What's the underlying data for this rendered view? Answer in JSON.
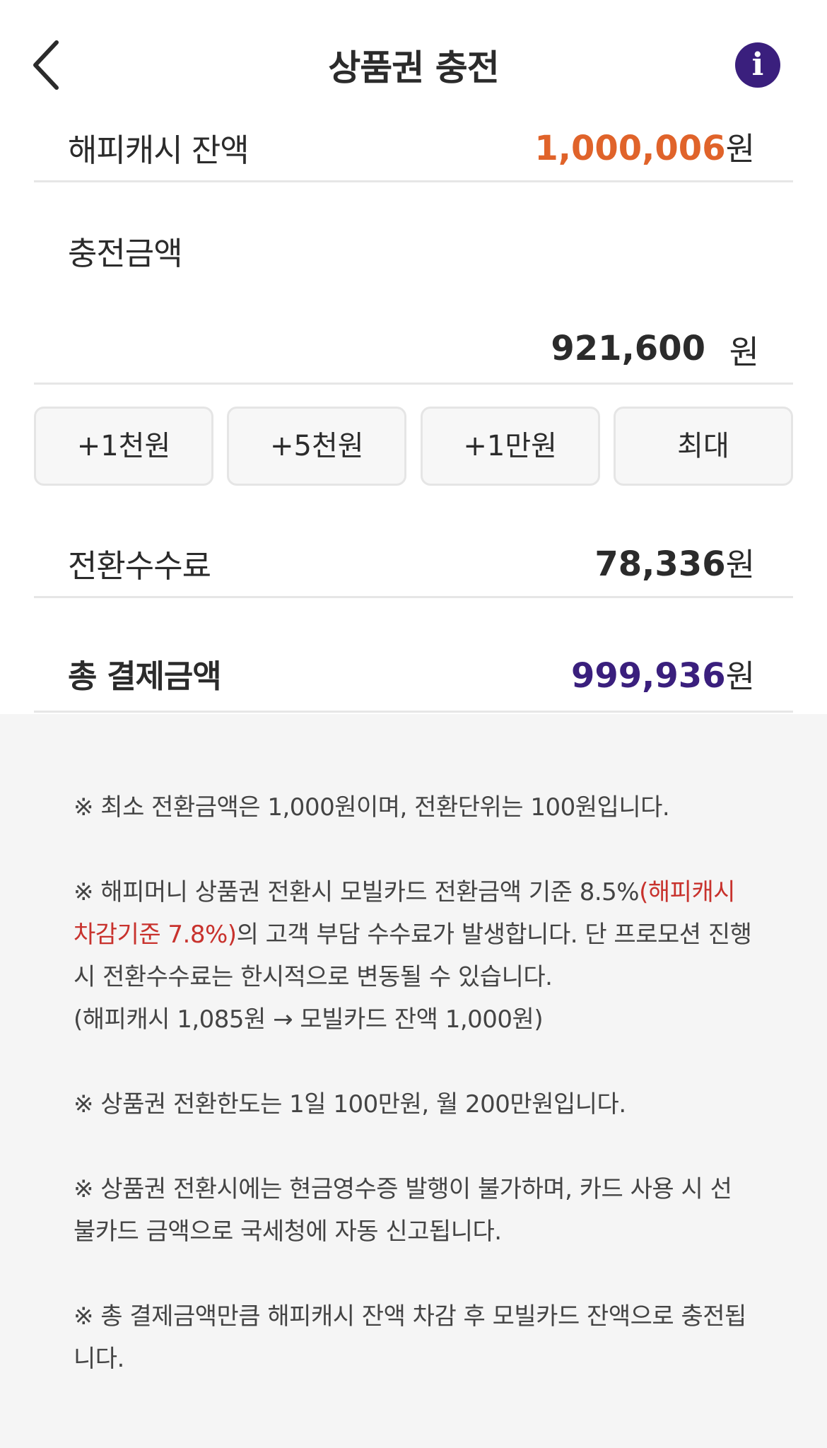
{
  "header": {
    "title": "상품권 충전",
    "back_icon": "chevron-left-icon",
    "info_icon": "info-icon",
    "info_glyph": "i",
    "info_color": "#3a1f7d"
  },
  "balance": {
    "label": "해피캐시 잔액",
    "amount": "1,000,006",
    "unit": "원",
    "amount_color": "#e0632a"
  },
  "charge": {
    "label": "충전금액",
    "value": "921,600",
    "unit": "원"
  },
  "quick_buttons": [
    {
      "label": "+1천원"
    },
    {
      "label": "+5천원"
    },
    {
      "label": "+1만원"
    },
    {
      "label": "최대"
    }
  ],
  "fee": {
    "label": "전환수수료",
    "amount": "78,336",
    "unit": "원"
  },
  "total": {
    "label": "총 결제금액",
    "amount": "999,936",
    "unit": "원",
    "amount_color": "#3a1f7d"
  },
  "notices": {
    "n1": "※ 최소 전환금액은 1,000원이며, 전환단위는 100원입니다.",
    "n2_pre": "※ 해피머니 상품권 전환시 모빌카드 전환금액 기준 8.5%",
    "n2_red": "(해피캐시 차감기준 7.8%)",
    "n2_post": "의 고객 부담 수수료가 발생합니다. 단 프로모션 진행시 전환수수료는 한시적으로 변동될 수 있습니다.",
    "n2_example": "(해피캐시 1,085원 → 모빌카드 잔액 1,000원)",
    "n3": "※ 상품권 전환한도는 1일 100만원, 월 200만원입니다.",
    "n4": "※ 상품권 전환시에는 현금영수증 발행이 불가하며, 카드 사용 시 선불카드 금액으로 국세청에 자동 신고됩니다.",
    "n5": "※ 총 결제금액만큼 해피캐시 잔액 차감 후 모빌카드 잔액으로 충전됩니다.",
    "highlight_color": "#c8322d"
  }
}
